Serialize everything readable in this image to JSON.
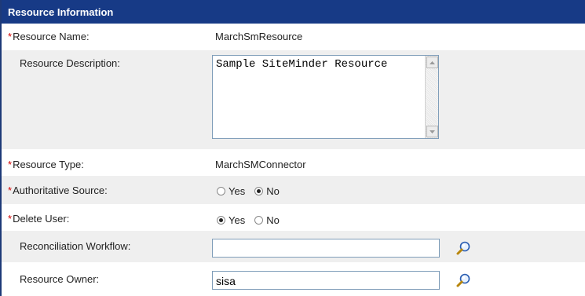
{
  "section_title": "Resource Information",
  "fields": {
    "resource_name": {
      "label": "Resource Name:",
      "required": "*",
      "value": "MarchSmResource"
    },
    "resource_description": {
      "label": "Resource Description:",
      "value": "Sample SiteMinder Resource"
    },
    "resource_type": {
      "label": "Resource Type:",
      "required": "*",
      "value": "MarchSMConnector"
    },
    "authoritative_source": {
      "label": "Authoritative Source:",
      "required": "*",
      "options": [
        "Yes",
        "No"
      ],
      "selected": "No"
    },
    "delete_user": {
      "label": "Delete User:",
      "required": "*",
      "options": [
        "Yes",
        "No"
      ],
      "selected": "Yes"
    },
    "reconciliation_workflow": {
      "label": "Reconciliation Workflow:",
      "value": "",
      "icon": "search-icon"
    },
    "resource_owner": {
      "label": "Resource Owner:",
      "value": "sisa",
      "icon": "search-icon"
    }
  },
  "colors": {
    "header_bg": "#173a86",
    "row_shade": "#efefef",
    "required_marker": "#d40000"
  }
}
